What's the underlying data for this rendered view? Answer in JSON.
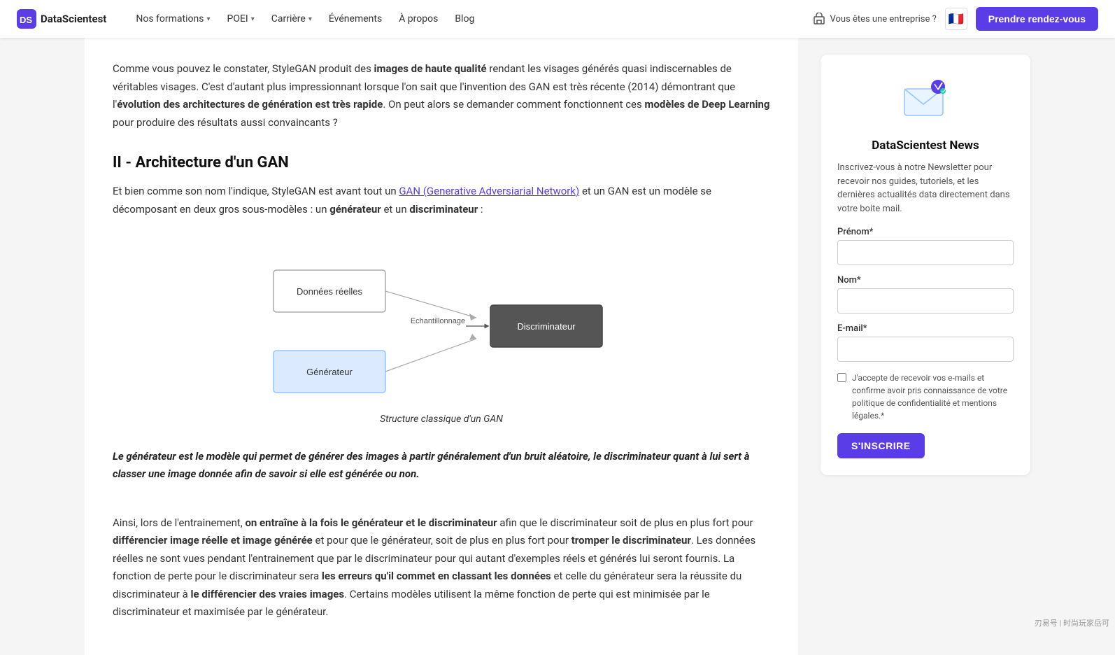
{
  "navbar": {
    "logo_text": "DataScientest",
    "nav_items": [
      {
        "label": "Nos formations",
        "has_chevron": true
      },
      {
        "label": "POEI",
        "has_chevron": true
      },
      {
        "label": "Carrière",
        "has_chevron": true
      },
      {
        "label": "Événements",
        "has_chevron": false
      },
      {
        "label": "À propos",
        "has_chevron": false
      },
      {
        "label": "Blog",
        "has_chevron": false
      }
    ],
    "enterprise_text": "Vous êtes une entreprise ?",
    "cta_label": "Prendre rendez-vous"
  },
  "article": {
    "intro_paragraph": "Comme vous pouvez le constater, StyleGAN produit des ",
    "intro_bold1": "images de haute qualité",
    "intro_mid": " rendant les visages générés quasi indiscernables de véritables visages. C'est d'autant plus impressionnant lorsque l'on sait que l'invention des GAN est très récente (2014) démontrant que l'",
    "intro_bold2": "évolution des architectures de génération est très rapide",
    "intro_end": ". On peut alors se demander comment fonctionnent ces ",
    "intro_bold3": "modèles de Deep Learning",
    "intro_end2": " pour produire des résultats aussi convaincants ?",
    "section_heading": "II - Architecture d'un GAN",
    "section_para1_start": "Et bien comme son nom l'indique, StyleGAN est avant tout un ",
    "section_link_text": "GAN (Generative Adversiarial Network)",
    "section_para1_mid": " et un GAN est un modèle se décomposant en deux gros sous-modèles : un ",
    "section_bold1": "générateur",
    "section_para1_end": " et un ",
    "section_bold2": "discriminateur",
    "section_para1_final": " :",
    "diagram_caption": "Structure classique d'un GAN",
    "diagram_nodes": {
      "donnees_reelles": "Données réelles",
      "generateur": "Générateur",
      "echantillonnage": "Echantillonnage",
      "discriminateur": "Discriminateur"
    },
    "callout_text": "Le générateur est le modèle qui permet de générer des images à partir généralement d'un bruit aléatoire, le discriminateur quant à lui sert à classer une image donnée afin de savoir si elle est générée ou non.",
    "body_para1_start": "Ainsi, lors de l'entrainement, ",
    "body_bold1": "on entraîne à la fois le générateur et le discriminateur",
    "body_para1_mid": " afin que le discriminateur soit de plus en plus fort pour ",
    "body_bold2": "différencier image réelle et image générée",
    "body_para1_mid2": " et pour que le générateur, soit de plus en plus fort pour ",
    "body_bold3": "tromper le discriminateur",
    "body_para1_end": ". Les données réelles ne sont vues pendant l'entrainement que par le discriminateur pour qui autant d'exemples réels et générés lui seront fournis. La fonction de perte pour le discriminateur sera ",
    "body_bold4": "les erreurs qu'il commet en classant les données",
    "body_para1_end2": " et celle du générateur sera la réussite du discriminateur à ",
    "body_bold5": "le différencier des vraies images",
    "body_para1_final": ". Certains modèles utilisent la même fonction de perte qui est minimisée par le discriminateur et maximisée par le générateur."
  },
  "sidebar": {
    "title": "DataScientest News",
    "description": "Inscrivez-vous à notre Newsletter pour recevoir nos guides, tutoriels, et les dernières actualités data directement dans votre boite mail.",
    "fields": {
      "prenom_label": "Prénom*",
      "prenom_placeholder": "",
      "nom_label": "Nom*",
      "nom_placeholder": "",
      "email_label": "E-mail*",
      "email_placeholder": ""
    },
    "checkbox_text": "J'accepte de recevoir vos e-mails et confirme avoir pris connaissance de votre politique de confidentialité et mentions légales.*",
    "submit_label": "S'INSCRIRE"
  },
  "watermark": "刃易号 | 时尚玩家岳可"
}
